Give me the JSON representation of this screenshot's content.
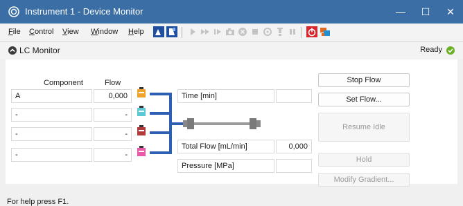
{
  "window": {
    "title": "Instrument 1 - Device Monitor",
    "minimize_glyph": "—",
    "maximize_glyph": "☐",
    "close_glyph": "✕"
  },
  "menu": [
    {
      "label": "File"
    },
    {
      "label": "Control"
    },
    {
      "label": "View"
    },
    {
      "label": "Window"
    },
    {
      "label": "Help"
    }
  ],
  "toolbar": {
    "icons": [
      "edit-icon",
      "monitor-flask-icon",
      "play-icon",
      "fast-forward-icon",
      "step-icon",
      "camera-icon",
      "stop-circle-icon",
      "stop-square-icon",
      "settings-icon",
      "lamp-icon",
      "pause-icon",
      "power-icon",
      "network-icon"
    ]
  },
  "panel": {
    "title": "LC Monitor",
    "status": "Ready"
  },
  "table": {
    "headers": {
      "component": "Component",
      "flow": "Flow"
    },
    "rows": [
      {
        "component": "A",
        "flow": "0,000",
        "bottle_color": "#f0a22e"
      },
      {
        "component": "-",
        "flow": "-",
        "bottle_color": "#5bc8d3"
      },
      {
        "component": "-",
        "flow": "-",
        "bottle_color": "#b13a3a"
      },
      {
        "component": "-",
        "flow": "-",
        "bottle_color": "#e85aa8"
      }
    ]
  },
  "readouts": [
    {
      "label": "Time [min]",
      "value": ""
    },
    {
      "label": "Total Flow [mL/min]",
      "value": "0,000"
    },
    {
      "label": "Pressure [MPa]",
      "value": ""
    }
  ],
  "buttons": {
    "stop_flow": "Stop Flow",
    "set_flow": "Set Flow...",
    "resume_idle": "Resume Idle",
    "hold": "Hold",
    "modify_gradient": "Modify Gradient..."
  },
  "statusbar": {
    "text": "For help press F1."
  },
  "colors": {
    "titlebar": "#3a6ea5",
    "flowline": "#2f5fb3",
    "ready_green": "#6ab023"
  }
}
